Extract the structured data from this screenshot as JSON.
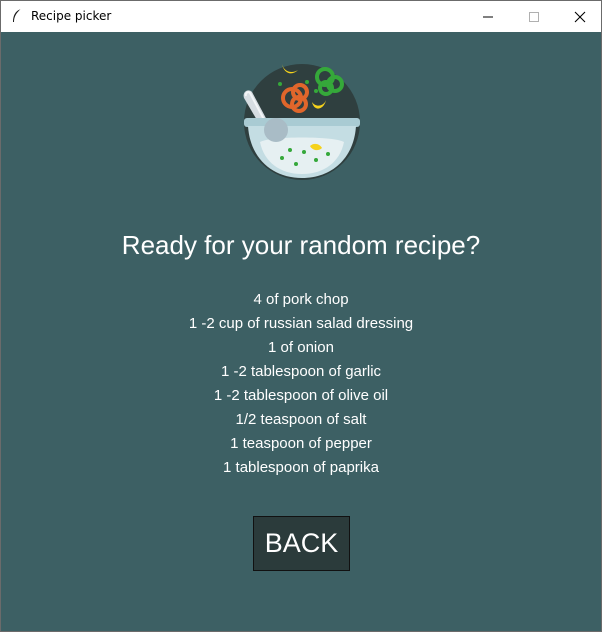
{
  "window": {
    "title": "Recipe picker",
    "icon": "feather-icon"
  },
  "controls": [
    "minimize-icon",
    "maximize-icon",
    "close-icon"
  ],
  "main": {
    "logo_icon": "salad-bowl-icon",
    "heading": "Ready for your random recipe?",
    "ingredients": [
      "4  of pork chop",
      "1 -2 cup of russian salad dressing",
      "1  of onion",
      "1 -2 tablespoon of garlic",
      "1 -2 tablespoon of olive oil",
      "1/2 teaspoon of salt",
      "1 teaspoon of pepper",
      "1 tablespoon of paprika"
    ],
    "back_label": "BACK"
  },
  "colors": {
    "background": "#3d6064",
    "button": "#2b3b3b",
    "text": "#ffffff"
  }
}
